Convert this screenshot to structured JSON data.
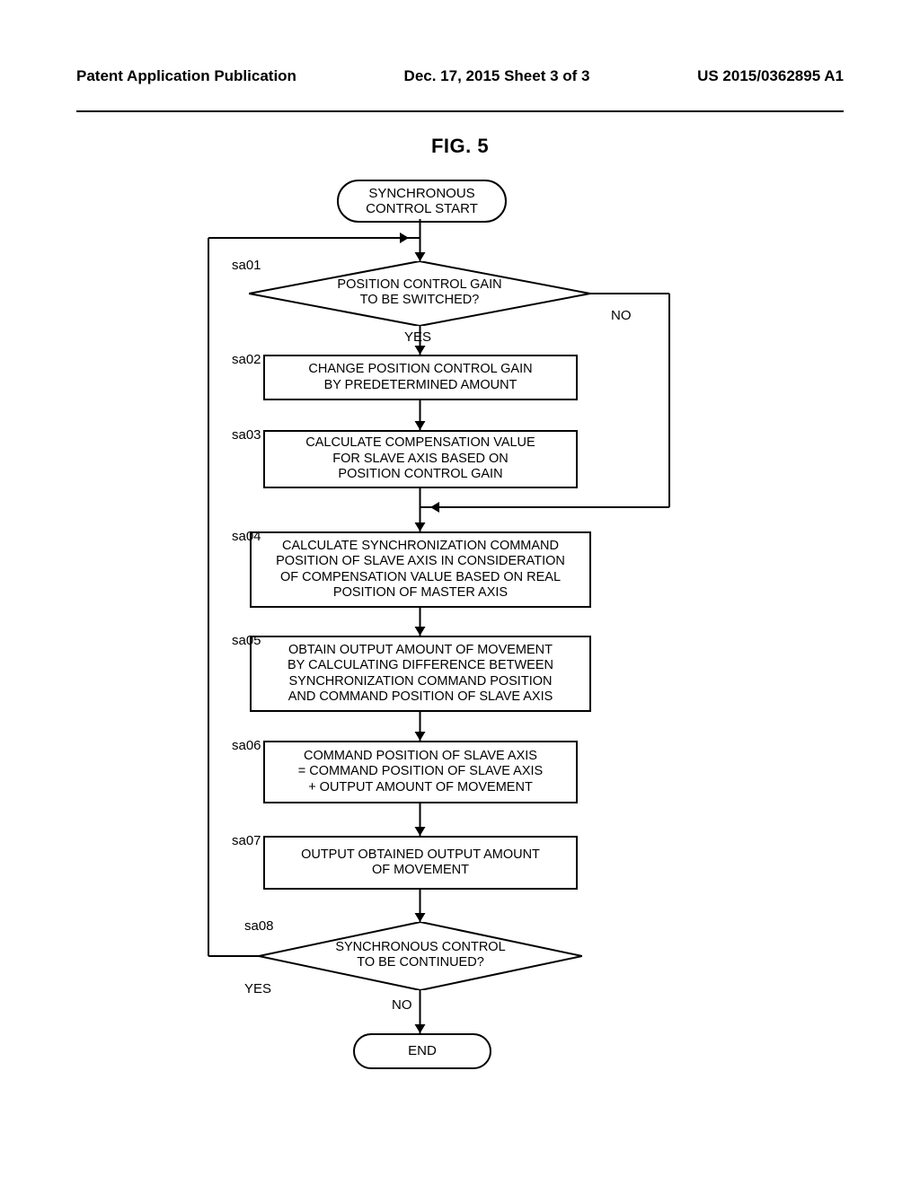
{
  "header": {
    "left": "Patent Application Publication",
    "center": "Dec. 17, 2015  Sheet 3 of 3",
    "right": "US 2015/0362895 A1"
  },
  "figure_title": "FIG. 5",
  "start": "SYNCHRONOUS\nCONTROL START",
  "steps": {
    "sa01": {
      "label": "sa01",
      "text": "POSITION CONTROL GAIN\nTO BE SWITCHED?",
      "yes": "YES",
      "no": "NO"
    },
    "sa02": {
      "label": "sa02",
      "text": "CHANGE POSITION CONTROL GAIN\nBY PREDETERMINED AMOUNT"
    },
    "sa03": {
      "label": "sa03",
      "text": "CALCULATE COMPENSATION VALUE\nFOR SLAVE AXIS BASED ON\nPOSITION CONTROL GAIN"
    },
    "sa04": {
      "label": "sa04",
      "text": "CALCULATE SYNCHRONIZATION COMMAND\nPOSITION OF SLAVE AXIS IN CONSIDERATION\nOF COMPENSATION VALUE BASED ON REAL\nPOSITION OF MASTER AXIS"
    },
    "sa05": {
      "label": "sa05",
      "text": "OBTAIN OUTPUT AMOUNT OF MOVEMENT\nBY CALCULATING DIFFERENCE BETWEEN\nSYNCHRONIZATION COMMAND POSITION\nAND COMMAND POSITION OF SLAVE AXIS"
    },
    "sa06": {
      "label": "sa06",
      "text": "COMMAND POSITION OF SLAVE AXIS\n= COMMAND POSITION OF SLAVE AXIS\n+ OUTPUT AMOUNT OF MOVEMENT"
    },
    "sa07": {
      "label": "sa07",
      "text": "OUTPUT OBTAINED OUTPUT AMOUNT\nOF MOVEMENT"
    },
    "sa08": {
      "label": "sa08",
      "text": "SYNCHRONOUS CONTROL\nTO BE CONTINUED?",
      "yes": "YES",
      "no": "NO"
    }
  },
  "end": "END"
}
